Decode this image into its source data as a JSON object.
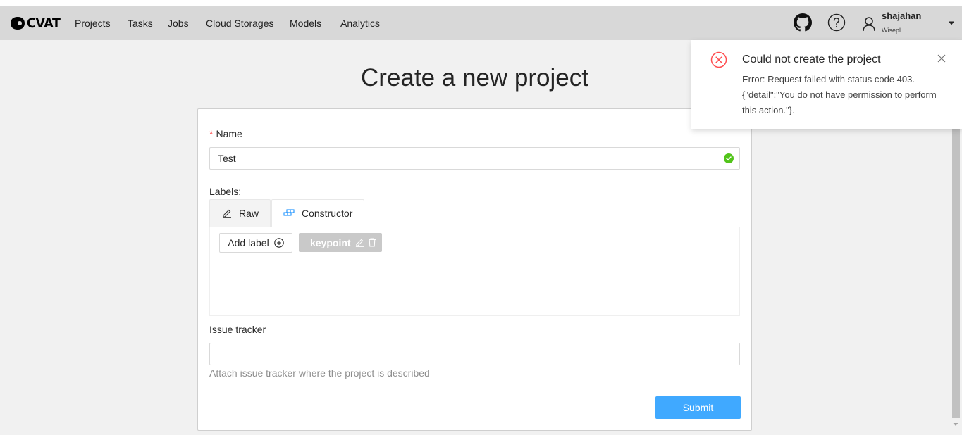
{
  "header": {
    "brand": "CVAT",
    "nav": [
      "Projects",
      "Tasks",
      "Jobs",
      "Cloud Storages",
      "Models",
      "Analytics"
    ],
    "icons": [
      "github-icon",
      "help-icon",
      "user-icon",
      "caret-down-icon"
    ],
    "user": {
      "name": "shajahan",
      "organization": "Wisepl"
    }
  },
  "page": {
    "title": "Create a new project"
  },
  "form": {
    "name_label": "Name",
    "name_value": "Test",
    "labels_label": "Labels:",
    "tabs": [
      "Raw",
      "Constructor"
    ],
    "active_tab": "Constructor",
    "add_label_button": "Add label",
    "label_tags": [
      "keypoint"
    ],
    "issue_tracker_label": "Issue tracker",
    "issue_tracker_value": "",
    "issue_tracker_help": "Attach issue tracker where the project is described",
    "submit_label": "Submit"
  },
  "notification": {
    "title": "Could not create the project",
    "message": "Error: Request failed with status code 403. {\"detail\":\"You do not have permission to perform this action.\"}."
  },
  "colors": {
    "header_bg": "#d8d8d8",
    "primary": "#40a9ff",
    "error": "#ff4d4f",
    "success": "#52c41a",
    "tag_bg": "#c9c9c9"
  }
}
